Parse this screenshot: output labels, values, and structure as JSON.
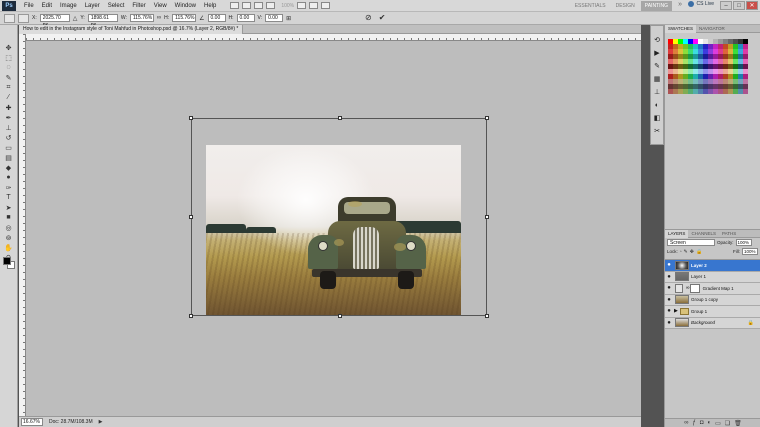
{
  "menubar": {
    "logo": "Ps",
    "items": [
      "File",
      "Edit",
      "Image",
      "Layer",
      "Select",
      "Filter",
      "View",
      "Window",
      "Help"
    ],
    "zoom": "100%",
    "workspaces": [
      "ESSENTIALS",
      "DESIGN",
      "PAINTING"
    ],
    "more": "»",
    "cs_live": "CS Live"
  },
  "optbar": {
    "x_label": "X:",
    "x_value": "2025.70 px",
    "y_label": "Y:",
    "y_value": "1898.61 px",
    "w_label": "W:",
    "w_value": "115.76%",
    "h_label": "H:",
    "h_value": "115.76%",
    "rot_value": "0.00",
    "h_skew_label": "H:",
    "h_skew_value": "0.00",
    "v_skew_label": "V:",
    "v_skew_value": "0.00"
  },
  "document": {
    "tab_title": "How to edit in the Instagram style of Toni Mahfud in Photoshop.psd @ 16.7% (Layer 2, RGB/8#) *"
  },
  "statusbar": {
    "zoom": "16.67%",
    "doc_size": "Doc: 28.7M/108.3M"
  },
  "panels": {
    "swatch_tabs": [
      "SWATCHES",
      "NAVIGATOR"
    ],
    "layer_tabs": [
      "LAYERS",
      "CHANNELS",
      "PATHS"
    ],
    "blend_mode": "Screen",
    "opacity_label": "Opacity:",
    "opacity_value": "100%",
    "lock_label": "Lock:",
    "fill_label": "Fill:",
    "fill_value": "100%"
  },
  "layers": [
    {
      "name": "Layer 2",
      "selected": true
    },
    {
      "name": "Layer 1",
      "selected": false
    },
    {
      "name": "Gradient Map 1",
      "selected": false
    },
    {
      "name": "Group 1 copy",
      "selected": false
    },
    {
      "name": "Group 1",
      "selected": false
    },
    {
      "name": "Background",
      "selected": false
    }
  ],
  "colors": {
    "selection": "#3876cf",
    "canvas": "#bdbdbd",
    "panel": "#c6c6c6"
  }
}
